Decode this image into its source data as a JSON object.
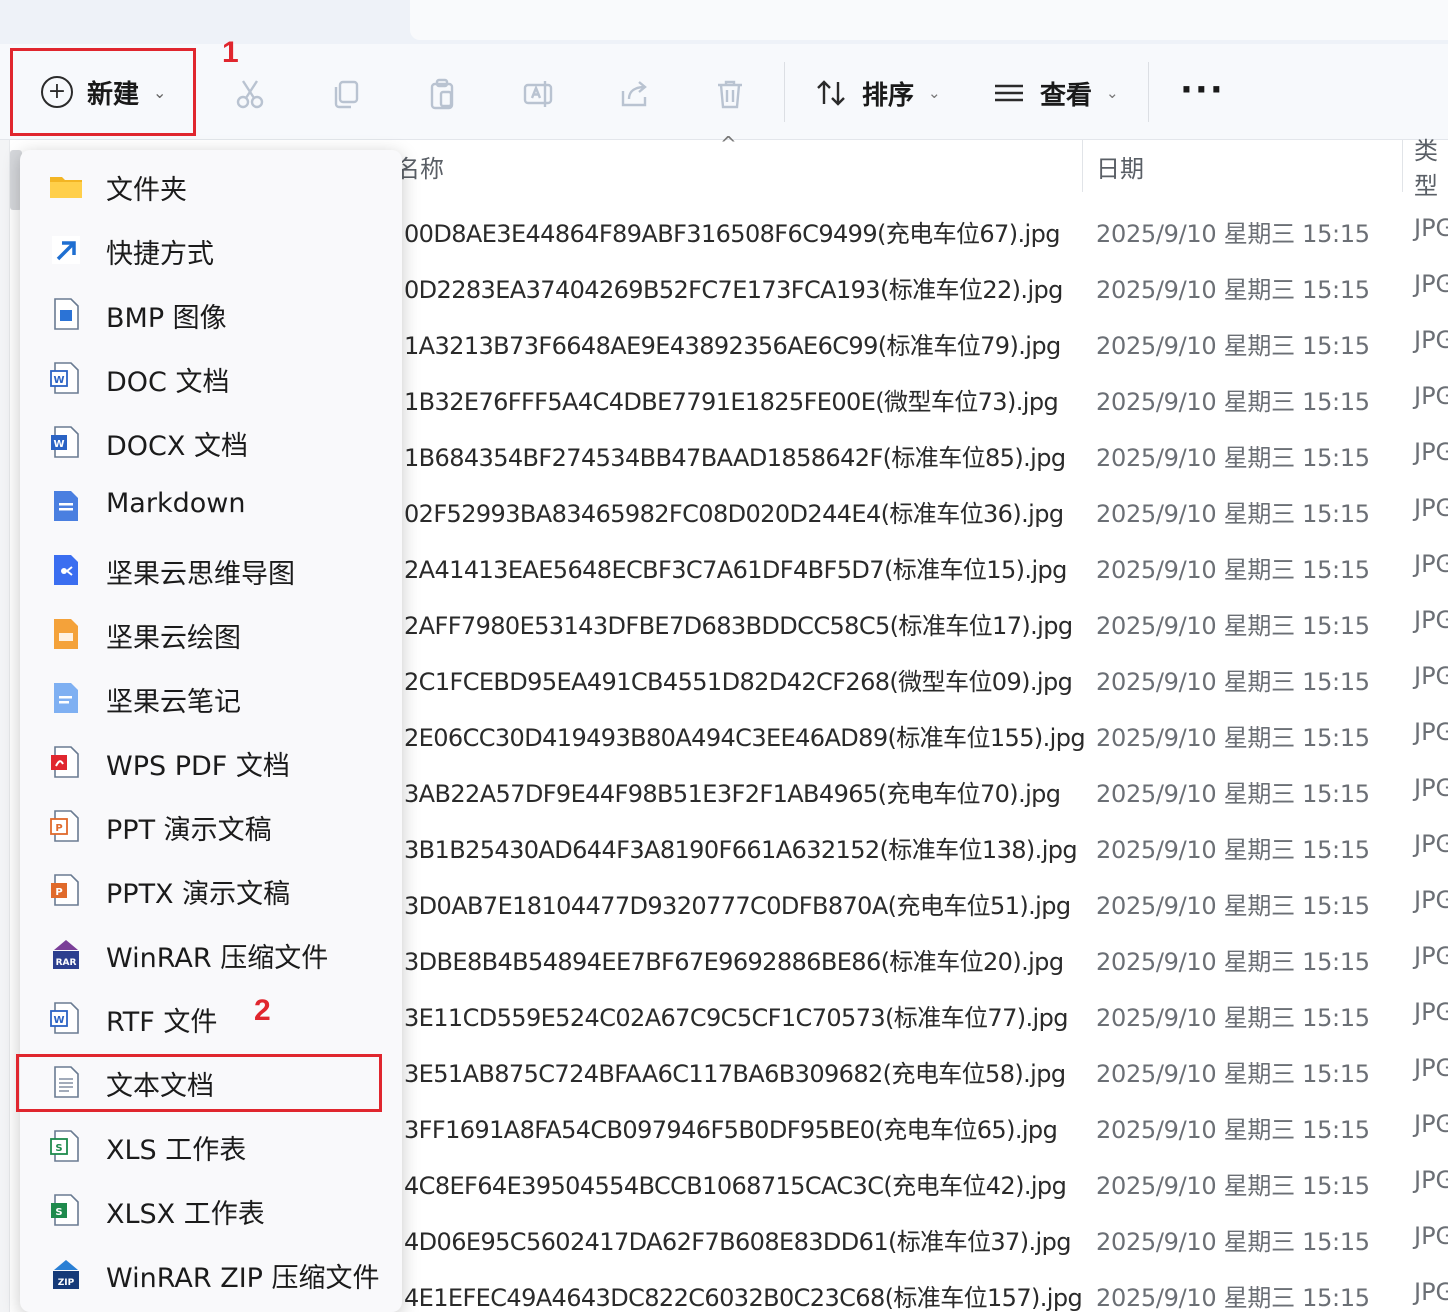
{
  "toolbar": {
    "new_label": "新建",
    "sort_label": "排序",
    "view_label": "查看",
    "more_label": "···",
    "annotation_1": "1",
    "icons": [
      "cut-icon",
      "copy-icon",
      "paste-icon",
      "rename-icon",
      "share-icon",
      "delete-icon"
    ]
  },
  "columns": {
    "name": "名称",
    "date": "日期",
    "type": "类型"
  },
  "menu": {
    "annotation_2": "2",
    "items": [
      {
        "label": "文件夹",
        "icon": "folder-icon"
      },
      {
        "label": "快捷方式",
        "icon": "shortcut-icon"
      },
      {
        "label": "BMP 图像",
        "icon": "bmp-image-icon"
      },
      {
        "label": "DOC 文档",
        "icon": "doc-icon"
      },
      {
        "label": "DOCX 文档",
        "icon": "docx-icon"
      },
      {
        "label": "Markdown",
        "icon": "markdown-icon"
      },
      {
        "label": "坚果云思维导图",
        "icon": "mindmap-icon"
      },
      {
        "label": "坚果云绘图",
        "icon": "drawing-icon"
      },
      {
        "label": "坚果云笔记",
        "icon": "note-icon"
      },
      {
        "label": "WPS PDF 文档",
        "icon": "pdf-icon"
      },
      {
        "label": "PPT 演示文稿",
        "icon": "ppt-icon"
      },
      {
        "label": "PPTX 演示文稿",
        "icon": "pptx-icon"
      },
      {
        "label": "WinRAR 压缩文件",
        "icon": "winrar-icon"
      },
      {
        "label": "RTF 文件",
        "icon": "rtf-icon"
      },
      {
        "label": "文本文档",
        "icon": "text-document-icon"
      },
      {
        "label": "XLS 工作表",
        "icon": "xls-icon"
      },
      {
        "label": "XLSX 工作表",
        "icon": "xlsx-icon"
      },
      {
        "label": "WinRAR ZIP 压缩文件",
        "icon": "winrar-zip-icon"
      }
    ]
  },
  "files": [
    {
      "name": "00D8AE3E44864F89ABF316508F6C9499(充电车位67).jpg",
      "date": "2025/9/10 星期三 15:15",
      "type": "JPG"
    },
    {
      "name": "0D2283EA37404269B52FC7E173FCA193(标准车位22).jpg",
      "date": "2025/9/10 星期三 15:15",
      "type": "JPG"
    },
    {
      "name": "1A3213B73F6648AE9E43892356AE6C99(标准车位79).jpg",
      "date": "2025/9/10 星期三 15:15",
      "type": "JPG"
    },
    {
      "name": "1B32E76FFF5A4C4DBE7791E1825FE00E(微型车位73).jpg",
      "date": "2025/9/10 星期三 15:15",
      "type": "JPG"
    },
    {
      "name": "1B684354BF274534BB47BAAD1858642F(标准车位85).jpg",
      "date": "2025/9/10 星期三 15:15",
      "type": "JPG"
    },
    {
      "name": "02F52993BA83465982FC08D020D244E4(标准车位36).jpg",
      "date": "2025/9/10 星期三 15:15",
      "type": "JPG"
    },
    {
      "name": "2A41413EAE5648ECBF3C7A61DF4BF5D7(标准车位15).jpg",
      "date": "2025/9/10 星期三 15:15",
      "type": "JPG"
    },
    {
      "name": "2AFF7980E53143DFBE7D683BDDCC58C5(标准车位17).jpg",
      "date": "2025/9/10 星期三 15:15",
      "type": "JPG"
    },
    {
      "name": "2C1FCEBD95EA491CB4551D82D42CF268(微型车位09).jpg",
      "date": "2025/9/10 星期三 15:15",
      "type": "JPG"
    },
    {
      "name": "2E06CC30D419493B80A494C3EE46AD89(标准车位155).jpg",
      "date": "2025/9/10 星期三 15:15",
      "type": "JPG"
    },
    {
      "name": "3AB22A57DF9E44F98B51E3F2F1AB4965(充电车位70).jpg",
      "date": "2025/9/10 星期三 15:15",
      "type": "JPG"
    },
    {
      "name": "3B1B25430AD644F3A8190F661A632152(标准车位138).jpg",
      "date": "2025/9/10 星期三 15:15",
      "type": "JPG"
    },
    {
      "name": "3D0AB7E18104477D9320777C0DFB870A(充电车位51).jpg",
      "date": "2025/9/10 星期三 15:15",
      "type": "JPG"
    },
    {
      "name": "3DBE8B4B54894EE7BF67E9692886BE86(标准车位20).jpg",
      "date": "2025/9/10 星期三 15:15",
      "type": "JPG"
    },
    {
      "name": "3E11CD559E524C02A67C9C5CF1C70573(标准车位77).jpg",
      "date": "2025/9/10 星期三 15:15",
      "type": "JPG"
    },
    {
      "name": "3E51AB875C724BFAA6C117BA6B309682(充电车位58).jpg",
      "date": "2025/9/10 星期三 15:15",
      "type": "JPG"
    },
    {
      "name": "3FF1691A8FA54CB097946F5B0DF95BE0(充电车位65).jpg",
      "date": "2025/9/10 星期三 15:15",
      "type": "JPG"
    },
    {
      "name": "4C8EF64E39504554BCCB1068715CAC3C(充电车位42).jpg",
      "date": "2025/9/10 星期三 15:15",
      "type": "JPG"
    },
    {
      "name": "4D06E95C5602417DA62F7B608E83DD61(标准车位37).jpg",
      "date": "2025/9/10 星期三 15:15",
      "type": "JPG"
    },
    {
      "name": "4E1EFEC49A4643DC822C6032B0C23C68(标准车位157).jpg",
      "date": "2025/9/10 星期三 15:15",
      "type": "JPG"
    }
  ]
}
